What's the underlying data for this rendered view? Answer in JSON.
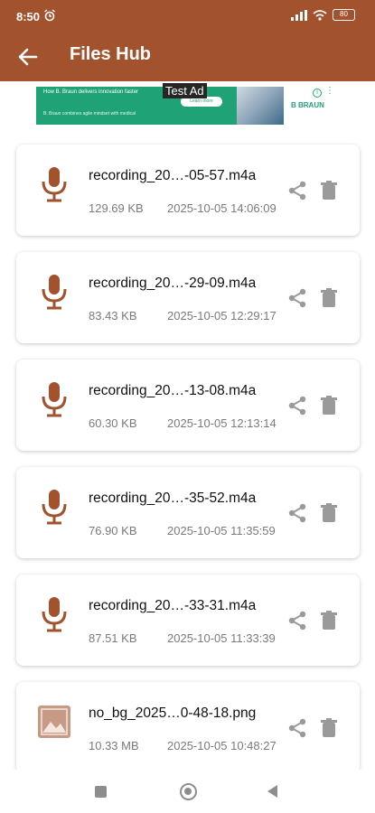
{
  "status_bar": {
    "time": "8:50",
    "battery": "80"
  },
  "app_bar": {
    "title": "Files Hub",
    "back_icon": "arrow-left-icon"
  },
  "ad": {
    "badge": "Test Ad",
    "headline": "How B. Braun delivers innovation faster",
    "subline": "B. Braun combines agile mindset with medical",
    "cta": "Learn more",
    "brand": "B BRAUN",
    "colors": {
      "brand_green": "#1fa275"
    }
  },
  "files": [
    {
      "name": "recording_20…-05-57.m4a",
      "size": "129.69 KB",
      "date": "2025-10-05 14:06:09",
      "icon": "microphone-icon"
    },
    {
      "name": "recording_20…-29-09.m4a",
      "size": "83.43 KB",
      "date": "2025-10-05 12:29:17",
      "icon": "microphone-icon"
    },
    {
      "name": "recording_20…-13-08.m4a",
      "size": "60.30 KB",
      "date": "2025-10-05 12:13:14",
      "icon": "microphone-icon"
    },
    {
      "name": "recording_20…-35-52.m4a",
      "size": "76.90 KB",
      "date": "2025-10-05 11:35:59",
      "icon": "microphone-icon"
    },
    {
      "name": "recording_20…-33-31.m4a",
      "size": "87.51 KB",
      "date": "2025-10-05 11:33:39",
      "icon": "microphone-icon"
    },
    {
      "name": "no_bg_2025…0-48-18.png",
      "size": "10.33 MB",
      "date": "2025-10-05 10:48:27",
      "icon": "image-icon"
    }
  ],
  "colors": {
    "primary": "#a2532e",
    "icon_brown": "#a2532e",
    "action_gray": "#9a9a9a"
  }
}
